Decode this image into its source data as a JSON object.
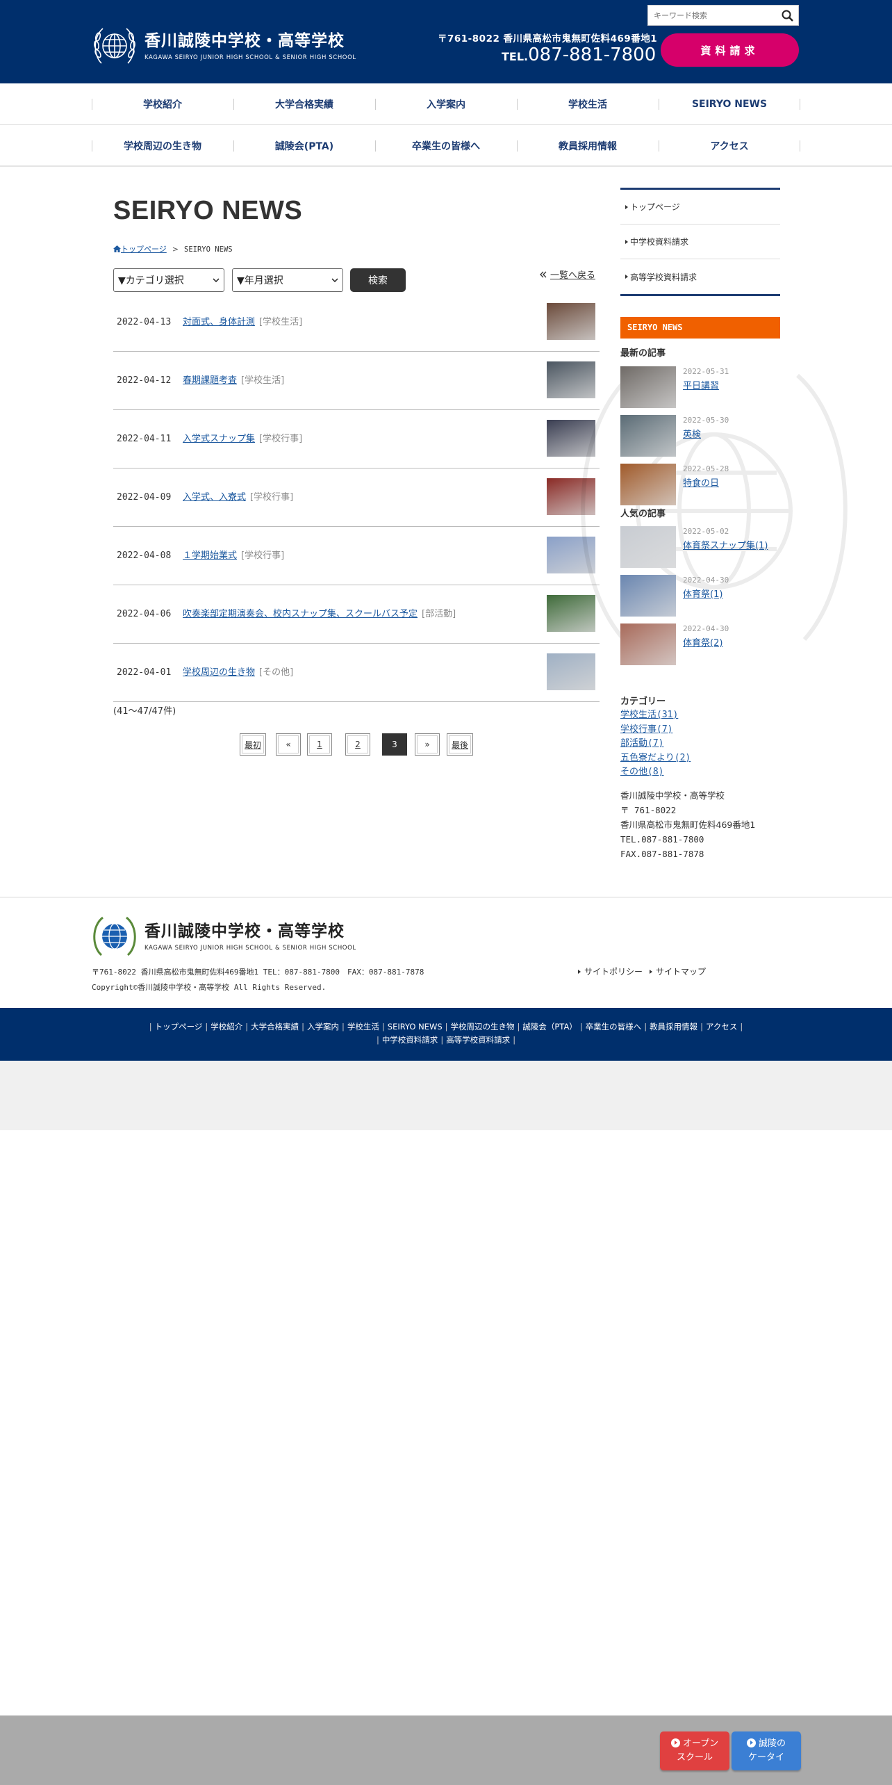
{
  "header": {
    "logo_jp": "香川誠陵中学校・高等学校",
    "logo_en": "KAGAWA SEIRYO JUNIOR HIGH SCHOOL & SENIOR HIGH SCHOOL",
    "search_placeholder": "キーワード検索",
    "address": "〒761-8022 香川県高松市鬼無町佐料469番地1",
    "tel_prefix": "TEL.",
    "tel_number": "087-881-7800",
    "request_button": "資料請求"
  },
  "nav": {
    "row1": [
      "学校紹介",
      "大学合格実績",
      "入学案内",
      "学校生活",
      "SEIRYO NEWS"
    ],
    "row2": [
      "学校周辺の生き物",
      "誠陵会(PTA)",
      "卒業生の皆様へ",
      "教員採用情報",
      "アクセス"
    ]
  },
  "main": {
    "page_title": "SEIRYO NEWS",
    "breadcrumb_home": "トップページ",
    "breadcrumb_sep": ">",
    "breadcrumb_current": "SEIRYO NEWS",
    "category_select": "▼カテゴリ選択",
    "month_select": "▼年月選択",
    "search_button": "検索",
    "back_link": "一覧へ戻る",
    "back_icon": "double-chevron-left",
    "posts": [
      {
        "date": "2022-04-13",
        "title": "対面式、身体計測",
        "category": "[学校生活]",
        "thumb": "#6b4a3a"
      },
      {
        "date": "2022-04-12",
        "title": "春期課題考査",
        "category": "[学校生活]",
        "thumb": "#4a5560"
      },
      {
        "date": "2022-04-11",
        "title": "入学式スナップ集",
        "category": "[学校行事]",
        "thumb": "#3a3e52"
      },
      {
        "date": "2022-04-09",
        "title": "入学式、入寮式",
        "category": "[学校行事]",
        "thumb": "#8a2a25"
      },
      {
        "date": "2022-04-08",
        "title": "１学期始業式",
        "category": "[学校行事]",
        "thumb": "#8aa0c8"
      },
      {
        "date": "2022-04-06",
        "title": "吹奏楽部定期演奏会、校内スナップ集、スクールバス予定",
        "category": "[部活動]",
        "thumb": "#3f6b3a"
      },
      {
        "date": "2022-04-01",
        "title": "学校周辺の生き物",
        "category": "[その他]",
        "thumb": "#9fb0c4"
      }
    ],
    "count_text": "(41～47/47件)",
    "pagination": [
      "最初",
      "«",
      "1",
      "2",
      "3",
      "»",
      "最後"
    ],
    "current_page": "3"
  },
  "sidebar": {
    "menu": [
      "トップページ",
      "中学校資料請求",
      "高等学校資料請求"
    ],
    "news_heading": "SEIRYO NEWS",
    "latest_heading": "最新の記事",
    "latest": [
      {
        "date": "2022-05-31",
        "title": "平日講習",
        "thumb": "#6f6a66"
      },
      {
        "date": "2022-05-30",
        "title": "英検",
        "thumb": "#5a6b75"
      },
      {
        "date": "2022-05-28",
        "title": "特食の日",
        "thumb": "#a05a2a"
      }
    ],
    "popular_heading": "人気の記事",
    "popular": [
      {
        "date": "2022-05-02",
        "title": "体育祭スナップ集(1)",
        "thumb": "#c8ccd2"
      },
      {
        "date": "2022-04-30",
        "title": "体育祭(1)",
        "thumb": "#6a86b0"
      },
      {
        "date": "2022-04-30",
        "title": "体育祭(2)",
        "thumb": "#a86a5a"
      }
    ],
    "category_heading": "カテゴリー",
    "categories": [
      "学校生活(31)",
      "学校行事(7)",
      "部活動(7)",
      "五色寮だより(2)",
      "その他(8)"
    ],
    "school_name": "香川誠陵中学校・高等学校",
    "postal": "〒 761-8022",
    "address": "香川県高松市鬼無町佐料469番地1",
    "tel": "TEL.087-881-7800",
    "fax": "FAX.087-881-7878"
  },
  "footer": {
    "logo_jp": "香川誠陵中学校・高等学校",
    "logo_en": "KAGAWA SEIRYO JUNIOR HIGH SCHOOL & SENIOR HIGH SCHOOL",
    "address_line": "〒761-8022 香川県高松市鬼無町佐料469番地1 TEL：087-881-7800　FAX：087-881-7878",
    "copyright": "Copyright©香川誠陵中学校・高等学校 All Rights Reserved.",
    "policy": "サイトポリシー",
    "sitemap": "サイトマップ",
    "nav_row1": [
      "トップページ",
      "学校紹介",
      "大学合格実績",
      "入学案内",
      "学校生活",
      "SEIRYO NEWS",
      "学校周辺の生き物",
      "誠陵会（PTA）",
      "卒業生の皆様へ",
      "教員採用情報",
      "アクセス"
    ],
    "nav_row2": [
      "中学校資料請求",
      "高等学校資料請求"
    ],
    "open_school_line1": "オープン",
    "open_school_line2": "スクール",
    "mobile_line1": "誠陵の",
    "mobile_line2": "ケータイ"
  },
  "colors": {
    "header_bg": "#002f6c",
    "request_button": "#d6006a",
    "news_heading_bg": "#f06000",
    "open_school_button": "#e04040",
    "mobile_button": "#3b7fd4"
  }
}
